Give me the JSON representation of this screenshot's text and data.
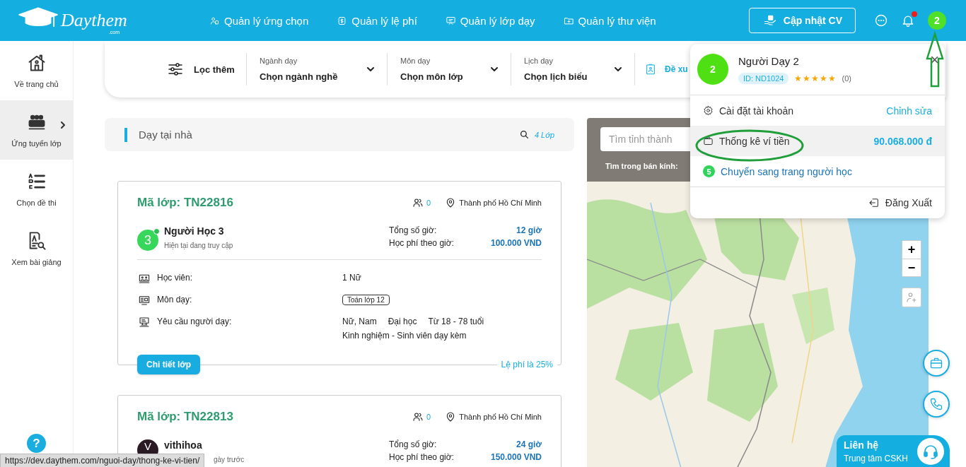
{
  "header": {
    "logo": "Daythem",
    "logo_suffix": ".com",
    "nav": [
      {
        "label": "Quản lý ứng chọn"
      },
      {
        "label": "Quản lý lệ phí"
      },
      {
        "label": "Quản lý lớp dạy"
      },
      {
        "label": "Quản lý thư viện"
      }
    ],
    "cv_button": "Cập nhật CV",
    "notification_badge": true,
    "avatar": "2"
  },
  "sidebar": {
    "items": [
      {
        "label": "Về trang chủ",
        "selected": false
      },
      {
        "label": "Ứng tuyển lớp",
        "selected": true
      },
      {
        "label": "Chọn đề thi",
        "selected": false
      },
      {
        "label": "Xem bài giảng",
        "selected": false
      }
    ],
    "help": "?"
  },
  "filter": {
    "label": "Lọc thêm",
    "dropdowns": [
      {
        "label": "Ngành dạy",
        "value": "Chọn ngành nghề"
      },
      {
        "label": "Môn dạy",
        "value": "Chọn môn lớp"
      },
      {
        "label": "Lịch dạy",
        "value": "Chọn lịch biểu"
      }
    ],
    "suggest": "Đề xu"
  },
  "list_header": {
    "title": "Dạy tại nhà",
    "count": "4 Lớp"
  },
  "cards": [
    {
      "kind": "full",
      "code": "Mã lớp: TN22816",
      "applicants": "0",
      "location": "Thành phố Hồ Chí Minh",
      "student": {
        "avatar": "3",
        "name": "Người Học 3",
        "status": "Hiện tại đang truy cập",
        "online": true
      },
      "hours_label": "Tổng số giờ:",
      "hours": "12 giờ",
      "fee_label": "Học phí theo giờ:",
      "fee": "100.000 VND",
      "details": [
        {
          "kind": "text",
          "label": "Học viên:",
          "lines": [
            [
              "1 Nữ"
            ]
          ]
        },
        {
          "kind": "tag",
          "label": "Môn dạy:",
          "lines": [
            [
              "Toán lớp 12"
            ]
          ]
        },
        {
          "kind": "text",
          "label": "Yêu cầu người dạy:",
          "lines": [
            [
              "Nữ, Nam",
              "Đại học",
              "Từ 18 - 78 tuổi"
            ],
            [
              "Kinh nghiệm - Sinh viên dạy kèm"
            ]
          ]
        }
      ],
      "button": "Chi tiết lớp",
      "commission": "Lệ phí là 25%"
    },
    {
      "kind": "partial",
      "code": "Mã lớp: TN22813",
      "applicants": "0",
      "location": "Thành phố Hồ Chí Minh",
      "student": {
        "avatar": "V",
        "name": "vithihoa",
        "status": "gày trước",
        "online": false
      },
      "hours_label": "Tổng số giờ:",
      "hours": "24 giờ",
      "fee_label": "Học phí theo giờ:",
      "fee": "150.000 VND"
    }
  ],
  "map": {
    "kind": "picture",
    "search_placeholder": "Tìm tỉnh thành",
    "radius_label": "Tìm trong bán kính:",
    "zoom_in": "+",
    "zoom_out": "−"
  },
  "profile_menu": {
    "avatar": "2",
    "name": "Người Dạy 2",
    "id": "ID: ND1024",
    "stars": 5,
    "reviews": "(0)",
    "close": "×",
    "items": [
      {
        "kind": "settings",
        "label": "Cài đặt tài khoản",
        "action": "Chỉnh sửa",
        "selected": false
      },
      {
        "kind": "wallet",
        "label": "Thống kê ví tiền",
        "value": "90.068.000 đ",
        "selected": true
      },
      {
        "kind": "switch",
        "badge": "5",
        "label": "Chuyển sang trang người học",
        "selected": false
      }
    ],
    "logout": "Đăng Xuất"
  },
  "contact": {
    "title": "Liên hệ",
    "subtitle": "Trung tâm CSKH"
  },
  "status_url": "https://dev.daythem.com/nguoi-day/thong-ke-vi-tien/"
}
